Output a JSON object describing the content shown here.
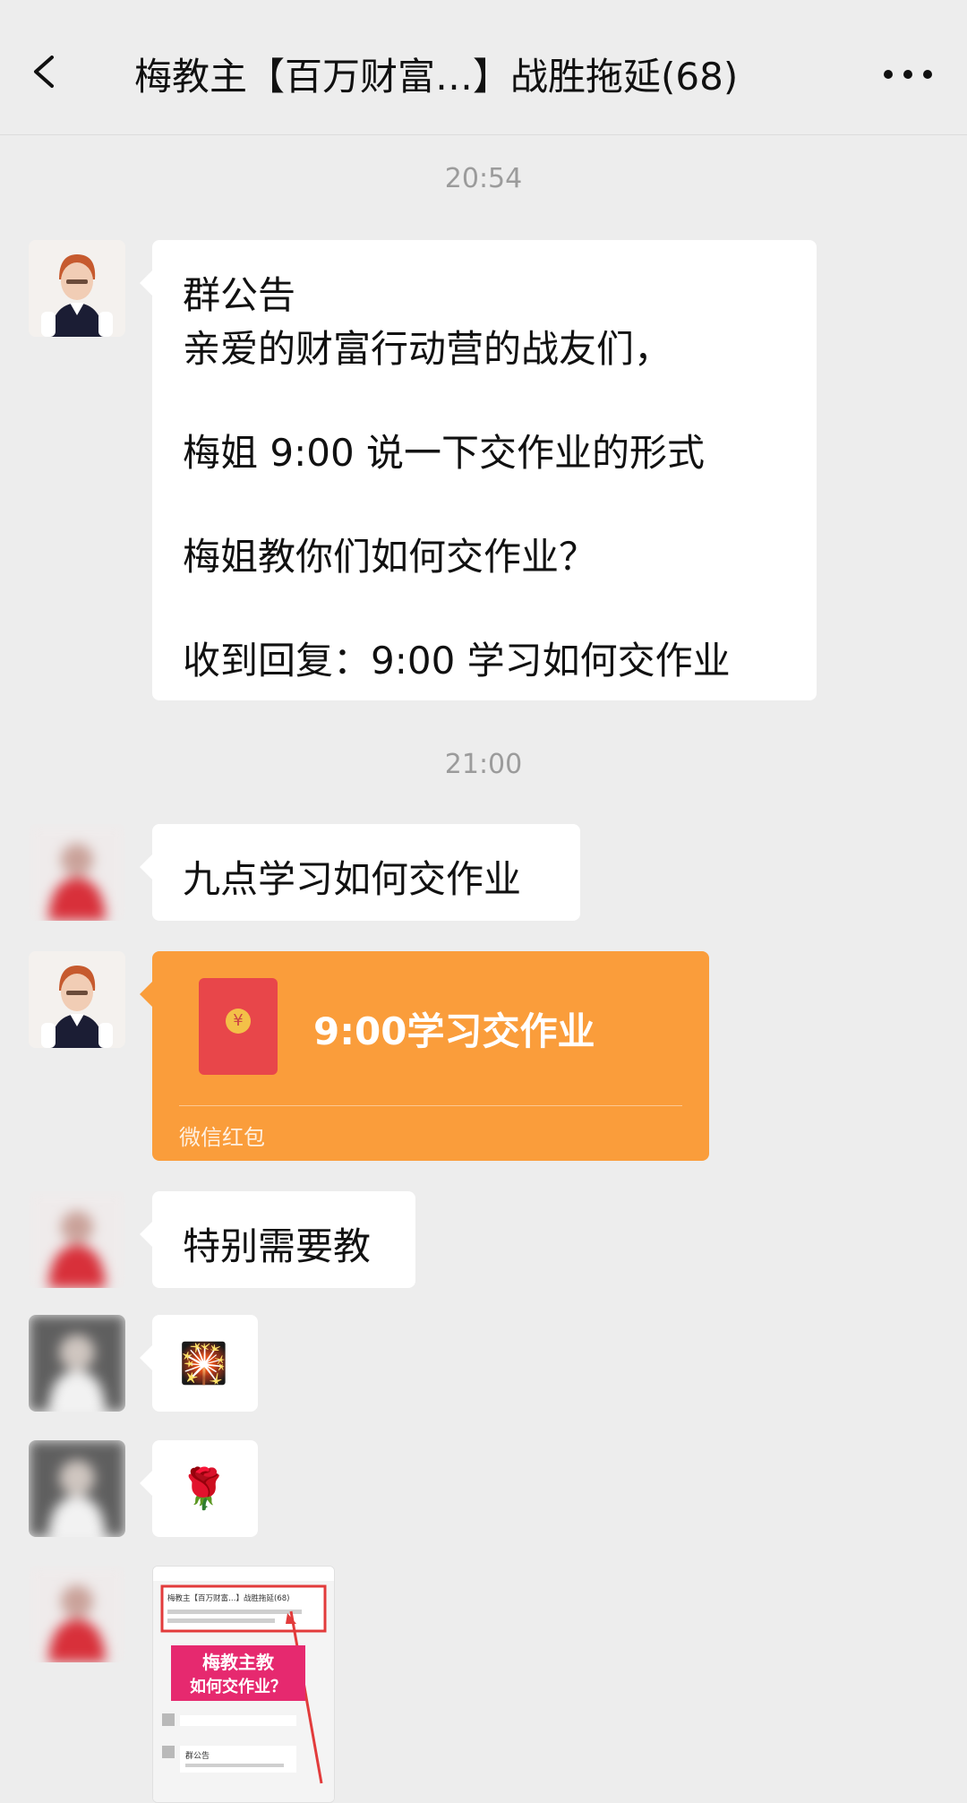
{
  "header": {
    "back_icon": "chevron-left-icon",
    "title": "梅教主【百万财富…】战胜拖延(68)",
    "more_icon": "more-dots-icon"
  },
  "messages": {
    "time1": "20:54",
    "announcement": {
      "line1": "群公告",
      "line2": "亲爱的财富行动营的战友们，",
      "line3": "梅姐 9:00 说一下交作业的形式",
      "line4": "梅姐教你们如何交作业？",
      "line5": "收到回复：9:00 学习如何交作业"
    },
    "time2": "21:00",
    "msg1": "九点学习如何交作业",
    "red_packet": {
      "text": "9:00学习交作业",
      "label": "微信红包",
      "icon": "red-envelope-icon"
    },
    "msg2": "特别需要教",
    "emoji1": "🎇",
    "emoji2": "🌹",
    "image": {
      "screenshot_title": "梅教主【百万财富…】战胜拖延(68)",
      "overlay_line1": "梅教主教",
      "overlay_line2": "如何交作业？",
      "caption": "群公告"
    }
  },
  "colors": {
    "background": "#ededed",
    "bubble": "#ffffff",
    "red_packet": "#fa9d3b"
  }
}
